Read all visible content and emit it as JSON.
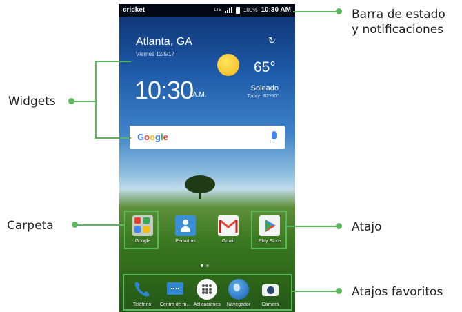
{
  "callouts": {
    "status": [
      "Barra de estado",
      "y notificaciones"
    ],
    "widgets": "Widgets",
    "folder": "Carpeta",
    "shortcut": "Atajo",
    "favorites": "Atajos favoritos"
  },
  "statusbar": {
    "carrier": "cricket",
    "network": "LTE",
    "battery": "100%",
    "time": "10:30 AM"
  },
  "weather": {
    "city": "Atlanta, GA",
    "date": "Viernes 12/5/17",
    "temp": "65°",
    "time": "10:30",
    "ampm": "A.M.",
    "condition": "Soleado",
    "range": "Today: 80°/60°"
  },
  "search": {
    "logo": "Google"
  },
  "apps": [
    {
      "label": "Google",
      "icon": "folder-icon"
    },
    {
      "label": "Personas",
      "icon": "contacts-icon"
    },
    {
      "label": "Gmail",
      "icon": "gmail-icon"
    },
    {
      "label": "Play Store",
      "icon": "play-store-icon"
    }
  ],
  "dock": [
    {
      "label": "Teléfono",
      "icon": "phone-icon"
    },
    {
      "label": "Centro de m...",
      "icon": "message-icon"
    },
    {
      "label": "Aplicaciones",
      "icon": "apps-grid-icon"
    },
    {
      "label": "Navegador",
      "icon": "globe-icon"
    },
    {
      "label": "Cámara",
      "icon": "camera-icon"
    }
  ],
  "colors": {
    "accent": "#5cb85c",
    "google_blue": "#4285f4",
    "google_red": "#ea4335",
    "google_yellow": "#fbbc05",
    "google_green": "#34a853"
  }
}
